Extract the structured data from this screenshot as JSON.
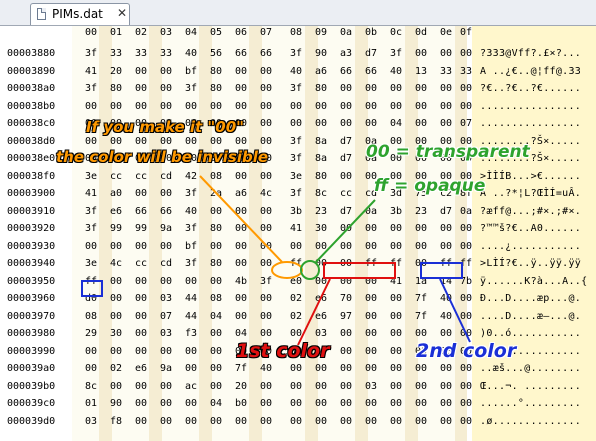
{
  "tab": {
    "title": "PIMs.dat",
    "close_glyph": "✕"
  },
  "hex_header": [
    "00",
    "01",
    "02",
    "03",
    "04",
    "05",
    "06",
    "07",
    "08",
    "09",
    "0a",
    "0b",
    "0c",
    "0d",
    "0e",
    "0f"
  ],
  "rows": [
    {
      "offset": "00003880",
      "bytes": [
        "3f",
        "33",
        "33",
        "33",
        "40",
        "56",
        "66",
        "66",
        "3f",
        "90",
        "a3",
        "d7",
        "3f",
        "00",
        "00",
        "00"
      ],
      "ascii": "?333@Vff?.£×?..."
    },
    {
      "offset": "00003890",
      "bytes": [
        "41",
        "20",
        "00",
        "00",
        "bf",
        "80",
        "00",
        "00",
        "40",
        "a6",
        "66",
        "66",
        "40",
        "13",
        "33",
        "33"
      ],
      "ascii": "A ..¿€..@¦ff@.33"
    },
    {
      "offset": "000038a0",
      "bytes": [
        "3f",
        "80",
        "00",
        "00",
        "3f",
        "80",
        "00",
        "00",
        "3f",
        "80",
        "00",
        "00",
        "00",
        "00",
        "00",
        "00"
      ],
      "ascii": "?€..?€..?€......"
    },
    {
      "offset": "000038b0",
      "bytes": [
        "00",
        "00",
        "00",
        "00",
        "00",
        "00",
        "00",
        "00",
        "00",
        "00",
        "00",
        "00",
        "00",
        "00",
        "00",
        "00"
      ],
      "ascii": "................"
    },
    {
      "offset": "000038c0",
      "bytes": [
        "00",
        "00",
        "00",
        "00",
        "00",
        "00",
        "00",
        "00",
        "00",
        "00",
        "00",
        "00",
        "04",
        "00",
        "00",
        "07"
      ],
      "ascii": "................"
    },
    {
      "offset": "000038d0",
      "bytes": [
        "00",
        "00",
        "00",
        "00",
        "00",
        "00",
        "00",
        "00",
        "3f",
        "8a",
        "d7",
        "0a",
        "00",
        "00",
        "00",
        "00"
      ],
      "ascii": "........?Š×....."
    },
    {
      "offset": "000038e0",
      "bytes": [
        "00",
        "00",
        "00",
        "00",
        "00",
        "00",
        "00",
        "00",
        "3f",
        "8a",
        "d7",
        "0a",
        "00",
        "00",
        "00",
        "00"
      ],
      "ascii": "........?Š×....."
    },
    {
      "offset": "000038f0",
      "bytes": [
        "3e",
        "cc",
        "cc",
        "cd",
        "42",
        "08",
        "00",
        "00",
        "3e",
        "80",
        "00",
        "00",
        "00",
        "00",
        "00",
        "00"
      ],
      "ascii": ">ÌÌÍB...>€......"
    },
    {
      "offset": "00003900",
      "bytes": [
        "41",
        "a0",
        "00",
        "00",
        "3f",
        "2a",
        "a6",
        "4c",
        "3f",
        "8c",
        "cc",
        "cd",
        "3d",
        "75",
        "c2",
        "8f"
      ],
      "ascii": "A ..?*¦L?ŒÌÍ=uÂ."
    },
    {
      "offset": "00003910",
      "bytes": [
        "3f",
        "e6",
        "66",
        "66",
        "40",
        "00",
        "00",
        "00",
        "3b",
        "23",
        "d7",
        "0a",
        "3b",
        "23",
        "d7",
        "0a"
      ],
      "ascii": "?æff@...;#×.;#×."
    },
    {
      "offset": "00003920",
      "bytes": [
        "3f",
        "99",
        "99",
        "9a",
        "3f",
        "80",
        "00",
        "00",
        "41",
        "30",
        "00",
        "00",
        "00",
        "00",
        "00",
        "00"
      ],
      "ascii": "?™™š?€..A0......"
    },
    {
      "offset": "00003930",
      "bytes": [
        "00",
        "00",
        "00",
        "00",
        "bf",
        "00",
        "00",
        "00",
        "00",
        "00",
        "00",
        "00",
        "00",
        "00",
        "00",
        "00"
      ],
      "ascii": "....¿..........."
    },
    {
      "offset": "00003940",
      "bytes": [
        "3e",
        "4c",
        "cc",
        "cd",
        "3f",
        "80",
        "00",
        "00",
        "ff",
        "00",
        "00",
        "ff",
        "ff",
        "00",
        "ff",
        "ff"
      ],
      "ascii": ">LÌÍ?€..ÿ..ÿÿ.ÿÿ"
    },
    {
      "offset": "00003950",
      "bytes": [
        "ff",
        "00",
        "00",
        "00",
        "00",
        "00",
        "4b",
        "3f",
        "e0",
        "00",
        "00",
        "00",
        "41",
        "1a",
        "14",
        "7b"
      ],
      "ascii": "ÿ......K?à...A..{"
    },
    {
      "offset": "00003960",
      "bytes": [
        "d0",
        "00",
        "00",
        "03",
        "44",
        "08",
        "00",
        "00",
        "02",
        "e6",
        "70",
        "00",
        "00",
        "7f",
        "40",
        "00"
      ],
      "ascii": "Ð...D....æp...@."
    },
    {
      "offset": "00003970",
      "bytes": [
        "08",
        "00",
        "00",
        "07",
        "44",
        "04",
        "00",
        "00",
        "02",
        "e6",
        "97",
        "00",
        "00",
        "7f",
        "40",
        "00"
      ],
      "ascii": "....D....æ—...@."
    },
    {
      "offset": "00003980",
      "bytes": [
        "29",
        "30",
        "00",
        "03",
        "f3",
        "00",
        "04",
        "00",
        "00",
        "03",
        "00",
        "00",
        "00",
        "00",
        "00",
        "00"
      ],
      "ascii": ")0..ó..........."
    },
    {
      "offset": "00003990",
      "bytes": [
        "00",
        "00",
        "00",
        "00",
        "00",
        "00",
        "00",
        "00",
        "00",
        "00",
        "00",
        "00",
        "00",
        "00",
        "00",
        "00"
      ],
      "ascii": "................"
    },
    {
      "offset": "000039a0",
      "bytes": [
        "00",
        "02",
        "e6",
        "9a",
        "00",
        "00",
        "7f",
        "40",
        "00",
        "00",
        "00",
        "00",
        "00",
        "00",
        "00",
        "00"
      ],
      "ascii": "..æš...@........"
    },
    {
      "offset": "000039b0",
      "bytes": [
        "8c",
        "00",
        "00",
        "00",
        "ac",
        "00",
        "20",
        "00",
        "00",
        "00",
        "00",
        "03",
        "00",
        "00",
        "00",
        "00"
      ],
      "ascii": "Œ...¬. ........."
    },
    {
      "offset": "000039c0",
      "bytes": [
        "01",
        "90",
        "00",
        "00",
        "00",
        "04",
        "b0",
        "00",
        "00",
        "00",
        "00",
        "00",
        "00",
        "00",
        "00",
        "00"
      ],
      "ascii": "......°........."
    },
    {
      "offset": "000039d0",
      "bytes": [
        "03",
        "f8",
        "00",
        "00",
        "00",
        "00",
        "00",
        "00",
        "00",
        "00",
        "00",
        "00",
        "00",
        "00",
        "00",
        "00"
      ],
      "ascii": ".ø.............."
    }
  ],
  "annotations": {
    "invisible_line1": "If you make it \"00\"",
    "invisible_line2": "the color will be invisible",
    "transparent": "00 = transparent",
    "opaque": "ff = opaque",
    "first_color": "1st color",
    "second_color": "2nd color"
  },
  "colors": {
    "orange": "#ff9900",
    "green": "#2ea32e",
    "red": "#e01010",
    "blue": "#1a2fd6"
  }
}
